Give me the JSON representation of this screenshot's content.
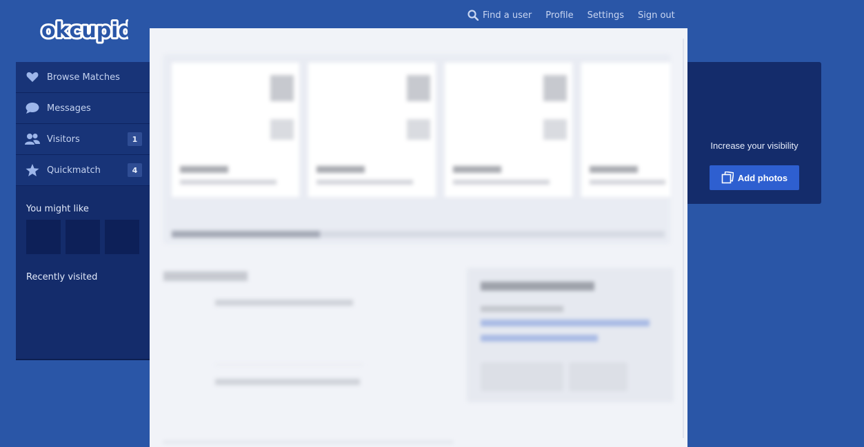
{
  "brand": {
    "logo_text": "okcupid"
  },
  "topnav": {
    "find_user": "Find a user",
    "profile": "Profile",
    "settings": "Settings",
    "sign_out": "Sign out"
  },
  "sidebar": {
    "items": [
      {
        "label": "Browse Matches",
        "icon": "heart-icon"
      },
      {
        "label": "Messages",
        "icon": "chat-bubble-icon"
      },
      {
        "label": "Visitors",
        "icon": "people-icon",
        "badge": "1"
      },
      {
        "label": "Quickmatch",
        "icon": "star-icon",
        "badge": "4"
      }
    ],
    "you_might_like": "You might like",
    "recently_visited": "Recently visited"
  },
  "promo": {
    "text": "Increase your visibility",
    "button": "Add photos"
  },
  "colors": {
    "page_bg": "#2a56a7",
    "sidebar_bg": "#142c6b",
    "accent_button": "#2e5fd0"
  }
}
